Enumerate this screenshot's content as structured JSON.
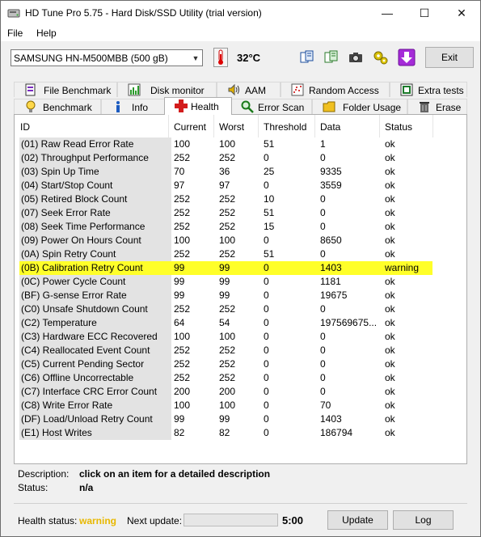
{
  "window": {
    "title": "HD Tune Pro 5.75 - Hard Disk/SSD Utility (trial version)",
    "minimize_glyph": "—",
    "maximize_glyph": "☐",
    "close_glyph": "✕"
  },
  "menu": {
    "file": "File",
    "help": "Help"
  },
  "toolbar": {
    "drive": "SAMSUNG HN-M500MBB (500 gB)",
    "temperature": "32°C",
    "exit_label": "Exit"
  },
  "tabs_top": [
    {
      "label": "File Benchmark",
      "icon": "file-benchmark-icon"
    },
    {
      "label": "Disk monitor",
      "icon": "disk-monitor-icon"
    },
    {
      "label": "AAM",
      "icon": "speaker-icon"
    },
    {
      "label": "Random Access",
      "icon": "random-access-icon"
    },
    {
      "label": "Extra tests",
      "icon": "extra-tests-icon"
    }
  ],
  "tabs_bottom": [
    {
      "label": "Benchmark",
      "icon": "benchmark-icon"
    },
    {
      "label": "Info",
      "icon": "info-icon"
    },
    {
      "label": "Health",
      "icon": "health-cross-icon"
    },
    {
      "label": "Error Scan",
      "icon": "magnifier-icon"
    },
    {
      "label": "Folder Usage",
      "icon": "folder-icon"
    },
    {
      "label": "Erase",
      "icon": "trash-icon"
    }
  ],
  "active_tab": "Health",
  "columns": [
    "ID",
    "Current",
    "Worst",
    "Threshold",
    "Data",
    "Status"
  ],
  "rows": [
    {
      "id": "(01) Raw Read Error Rate",
      "current": "100",
      "worst": "100",
      "threshold": "51",
      "data": "1",
      "status": "ok"
    },
    {
      "id": "(02) Throughput Performance",
      "current": "252",
      "worst": "252",
      "threshold": "0",
      "data": "0",
      "status": "ok"
    },
    {
      "id": "(03) Spin Up Time",
      "current": "70",
      "worst": "36",
      "threshold": "25",
      "data": "9335",
      "status": "ok"
    },
    {
      "id": "(04) Start/Stop Count",
      "current": "97",
      "worst": "97",
      "threshold": "0",
      "data": "3559",
      "status": "ok"
    },
    {
      "id": "(05) Retired Block Count",
      "current": "252",
      "worst": "252",
      "threshold": "10",
      "data": "0",
      "status": "ok"
    },
    {
      "id": "(07) Seek Error Rate",
      "current": "252",
      "worst": "252",
      "threshold": "51",
      "data": "0",
      "status": "ok"
    },
    {
      "id": "(08) Seek Time Performance",
      "current": "252",
      "worst": "252",
      "threshold": "15",
      "data": "0",
      "status": "ok"
    },
    {
      "id": "(09) Power On Hours Count",
      "current": "100",
      "worst": "100",
      "threshold": "0",
      "data": "8650",
      "status": "ok"
    },
    {
      "id": "(0A) Spin Retry Count",
      "current": "252",
      "worst": "252",
      "threshold": "51",
      "data": "0",
      "status": "ok"
    },
    {
      "id": "(0B) Calibration Retry Count",
      "current": "99",
      "worst": "99",
      "threshold": "0",
      "data": "1403",
      "status": "warning",
      "highlight": true
    },
    {
      "id": "(0C) Power Cycle Count",
      "current": "99",
      "worst": "99",
      "threshold": "0",
      "data": "1181",
      "status": "ok"
    },
    {
      "id": "(BF) G-sense Error Rate",
      "current": "99",
      "worst": "99",
      "threshold": "0",
      "data": "19675",
      "status": "ok"
    },
    {
      "id": "(C0) Unsafe Shutdown Count",
      "current": "252",
      "worst": "252",
      "threshold": "0",
      "data": "0",
      "status": "ok"
    },
    {
      "id": "(C2) Temperature",
      "current": "64",
      "worst": "54",
      "threshold": "0",
      "data": "197569675...",
      "status": "ok"
    },
    {
      "id": "(C3) Hardware ECC Recovered",
      "current": "100",
      "worst": "100",
      "threshold": "0",
      "data": "0",
      "status": "ok"
    },
    {
      "id": "(C4) Reallocated Event Count",
      "current": "252",
      "worst": "252",
      "threshold": "0",
      "data": "0",
      "status": "ok"
    },
    {
      "id": "(C5) Current Pending Sector",
      "current": "252",
      "worst": "252",
      "threshold": "0",
      "data": "0",
      "status": "ok"
    },
    {
      "id": "(C6) Offline Uncorrectable",
      "current": "252",
      "worst": "252",
      "threshold": "0",
      "data": "0",
      "status": "ok"
    },
    {
      "id": "(C7) Interface CRC Error Count",
      "current": "200",
      "worst": "200",
      "threshold": "0",
      "data": "0",
      "status": "ok"
    },
    {
      "id": "(C8) Write Error Rate",
      "current": "100",
      "worst": "100",
      "threshold": "0",
      "data": "70",
      "status": "ok"
    },
    {
      "id": "(DF) Load/Unload Retry Count",
      "current": "99",
      "worst": "99",
      "threshold": "0",
      "data": "1403",
      "status": "ok"
    },
    {
      "id": "(E1) Host Writes",
      "current": "82",
      "worst": "82",
      "threshold": "0",
      "data": "186794",
      "status": "ok"
    }
  ],
  "details": {
    "description_label": "Description:",
    "description_value": "click on an item for a detailed description",
    "status_label": "Status:",
    "status_value": "n/a"
  },
  "footer": {
    "health_label": "Health status:",
    "health_value": "warning",
    "health_color": "#e8b800",
    "next_update_label": "Next update:",
    "progress_fraction": 0.0,
    "timer": "5:00",
    "update_label": "Update",
    "log_label": "Log"
  },
  "colors": {
    "highlight": "#ffff29",
    "id_column_bg": "#e3e3e3"
  }
}
